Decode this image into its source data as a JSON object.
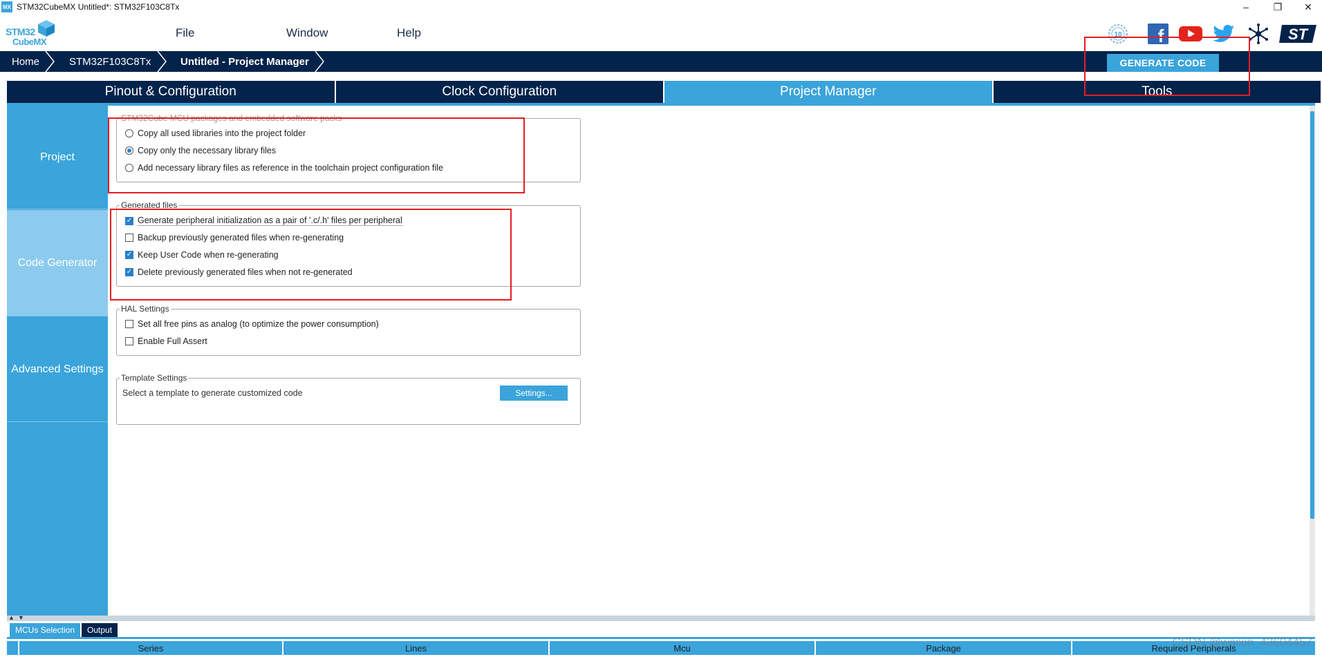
{
  "window": {
    "app_icon": "MX",
    "title": "STM32CubeMX Untitled*: STM32F103C8Tx",
    "minimize": "–",
    "restore": "❐",
    "close": "✕"
  },
  "logo": {
    "line1": "STM32",
    "line2": "CubeMX"
  },
  "menu": {
    "file": "File",
    "window": "Window",
    "help": "Help"
  },
  "social": {
    "anniversary": "10",
    "facebook": "f",
    "youtube": "▶",
    "twitter": "twitter-bird",
    "network": "network-star",
    "st": "ST"
  },
  "breadcrumb": {
    "home": "Home",
    "mcu": "STM32F103C8Tx",
    "current": "Untitled - Project Manager"
  },
  "generate_button": "GENERATE CODE",
  "tabs": [
    "Pinout & Configuration",
    "Clock Configuration",
    "Project Manager",
    "Tools"
  ],
  "active_tab": 2,
  "sidebar": {
    "items": [
      {
        "label": "Project"
      },
      {
        "label": "Code Generator"
      },
      {
        "label": "Advanced Settings"
      }
    ],
    "active": 1
  },
  "packages_group": {
    "legend": "STM32Cube MCU packages and embedded software packs",
    "options": [
      {
        "label": "Copy all used libraries into the project folder",
        "selected": false
      },
      {
        "label": "Copy only the necessary library files",
        "selected": true
      },
      {
        "label": "Add necessary library files as reference in the toolchain project configuration file",
        "selected": false
      }
    ]
  },
  "generated_files": {
    "legend": "Generated files",
    "options": [
      {
        "label": "Generate peripheral initialization as a pair of '.c/.h' files per peripheral",
        "checked": true
      },
      {
        "label": "Backup previously generated files when re-generating",
        "checked": false
      },
      {
        "label": "Keep User Code when re-generating",
        "checked": true
      },
      {
        "label": "Delete previously generated files when not re-generated",
        "checked": true
      }
    ]
  },
  "hal_settings": {
    "legend": "HAL Settings",
    "options": [
      {
        "label": "Set all free pins as analog (to optimize the power consumption)",
        "checked": false
      },
      {
        "label": "Enable Full Assert",
        "checked": false
      }
    ]
  },
  "template_settings": {
    "legend": "Template Settings",
    "text": "Select a template to generate customized code",
    "button": "Settings..."
  },
  "bottom": {
    "tabs": [
      "MCUs Selection",
      "Output"
    ],
    "active_tab": 1,
    "columns": [
      "Series",
      "Lines",
      "Mcu",
      "Package",
      "Required Peripherals"
    ]
  },
  "watermark": "CSDN @weixin_43604457",
  "colors": {
    "navy": "#03234b",
    "accent": "#3aa4db",
    "highlight": "#e51c23"
  }
}
